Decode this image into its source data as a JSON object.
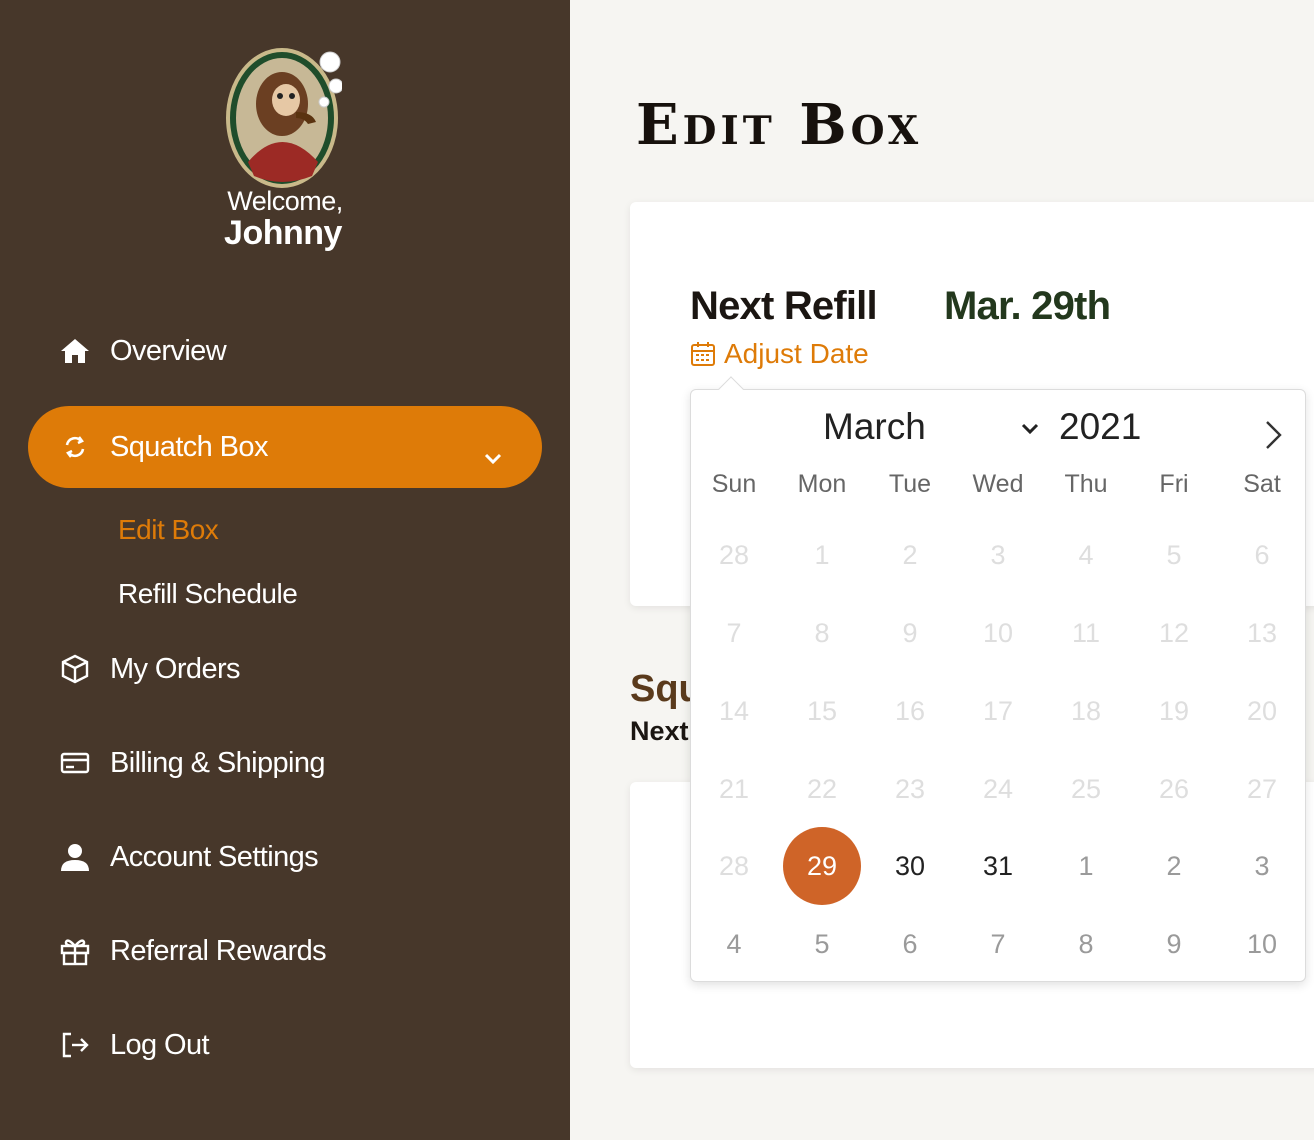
{
  "sidebar": {
    "welcome": "Welcome,",
    "username": "Johnny",
    "nav": {
      "overview": "Overview",
      "squatch_box": "Squatch Box",
      "edit_box": "Edit Box",
      "refill_schedule": "Refill Schedule",
      "my_orders": "My Orders",
      "billing": "Billing & Shipping",
      "account": "Account Settings",
      "referral": "Referral Rewards",
      "logout": "Log Out"
    }
  },
  "colors": {
    "sidebar": "#47372a",
    "accent": "#de7b08",
    "selected_day": "#cf6428",
    "date_green": "#23381d"
  },
  "main": {
    "title": "Edit Box",
    "next_refill_label": "Next Refill",
    "next_refill_date": "Mar. 29th",
    "adjust_date": "Adjust Date",
    "section_heading_partial": "Squ",
    "section_next_partial": "Next"
  },
  "calendar": {
    "month": "March",
    "year": "2021",
    "weekdays": [
      "Sun",
      "Mon",
      "Tue",
      "Wed",
      "Thu",
      "Fri",
      "Sat"
    ],
    "weeks": [
      [
        "28",
        "1",
        "2",
        "3",
        "4",
        "5",
        "6"
      ],
      [
        "7",
        "8",
        "9",
        "10",
        "11",
        "12",
        "13"
      ],
      [
        "14",
        "15",
        "16",
        "17",
        "18",
        "19",
        "20"
      ],
      [
        "21",
        "22",
        "23",
        "24",
        "25",
        "26",
        "27"
      ],
      [
        "28",
        "29",
        "30",
        "31",
        "1",
        "2",
        "3"
      ],
      [
        "4",
        "5",
        "6",
        "7",
        "8",
        "9",
        "10"
      ]
    ],
    "selected": "29",
    "enabled_days": [
      "29",
      "30",
      "31"
    ]
  }
}
